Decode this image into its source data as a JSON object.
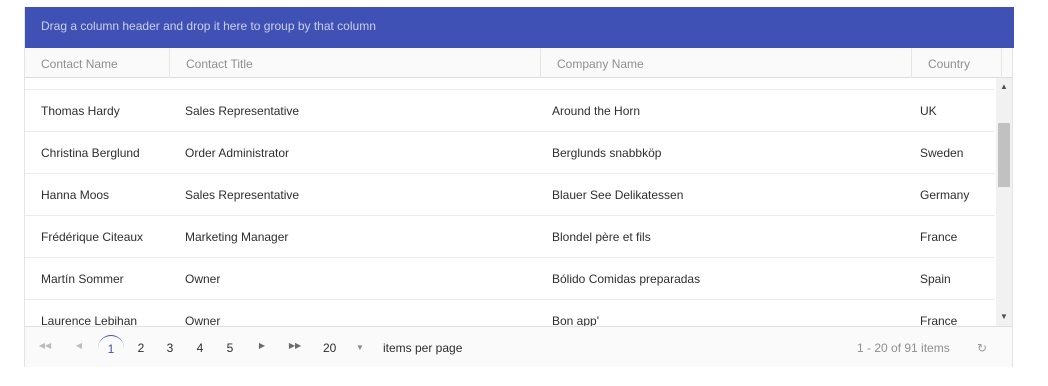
{
  "group_bar": {
    "text": "Drag a column header and drop it here to group by that column"
  },
  "columns": [
    "Contact Name",
    "Contact Title",
    "Company Name",
    "Country"
  ],
  "rows": [
    {
      "contact_name": "Thomas Hardy",
      "contact_title": "Sales Representative",
      "company_name": "Around the Horn",
      "country": "UK"
    },
    {
      "contact_name": "Christina Berglund",
      "contact_title": "Order Administrator",
      "company_name": "Berglunds snabbköp",
      "country": "Sweden"
    },
    {
      "contact_name": "Hanna Moos",
      "contact_title": "Sales Representative",
      "company_name": "Blauer See Delikatessen",
      "country": "Germany"
    },
    {
      "contact_name": "Frédérique Citeaux",
      "contact_title": "Marketing Manager",
      "company_name": "Blondel père et fils",
      "country": "France"
    },
    {
      "contact_name": "Martín Sommer",
      "contact_title": "Owner",
      "company_name": "Bólido Comidas preparadas",
      "country": "Spain"
    },
    {
      "contact_name": "Laurence Lebihan",
      "contact_title": "Owner",
      "company_name": "Bon app'",
      "country": "France"
    }
  ],
  "pager": {
    "pages": [
      "1",
      "2",
      "3",
      "4",
      "5"
    ],
    "current_page": "1",
    "page_size": "20",
    "items_per_page_label": "items per page",
    "info": "1 - 20 of 91 items"
  },
  "icons": {
    "first": "first-page-icon",
    "prev": "prev-page-icon",
    "next": "next-page-icon",
    "last": "last-page-icon",
    "refresh": "refresh-icon",
    "dropdown": "chevron-down-icon"
  },
  "colors": {
    "accent": "#3f51b5",
    "header_bg": "#fafafa",
    "border": "#e4e4e4"
  }
}
